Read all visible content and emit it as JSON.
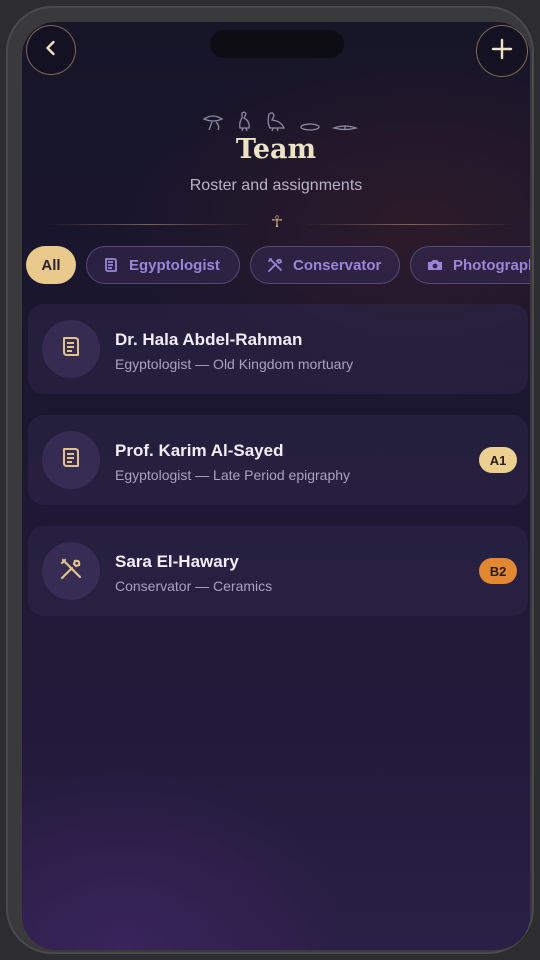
{
  "header": {
    "title": "Team",
    "subtitle": "Roster and assignments",
    "back_icon": "chevron-left-icon",
    "add_icon": "plus-icon"
  },
  "filters": [
    {
      "label": "All",
      "selected": true
    },
    {
      "label": "Egyptologist",
      "icon": "scroll-icon",
      "selected": false
    },
    {
      "label": "Conservator",
      "icon": "tools-icon",
      "selected": false
    },
    {
      "label": "Photographer",
      "icon": "camera-icon",
      "selected": false
    }
  ],
  "members": [
    {
      "name": "Dr. Hala Abdel-Rahman",
      "role": "Egyptologist — Old Kingdom mortuary",
      "icon": "scroll-icon",
      "badge": ""
    },
    {
      "name": "Prof. Karim Al-Sayed",
      "role": "Egyptologist — Late Period epigraphy",
      "icon": "scroll-icon",
      "badge": "A1"
    },
    {
      "name": "Sara El-Hawary",
      "role": "Conservator — Ceramics",
      "icon": "tools-icon",
      "badge": "B2"
    }
  ],
  "colors": {
    "accent_gold": "#e9c98c",
    "badge_a1": "#ecd08f",
    "badge_b2": "#e28732",
    "chip_text": "#9a86d8"
  }
}
